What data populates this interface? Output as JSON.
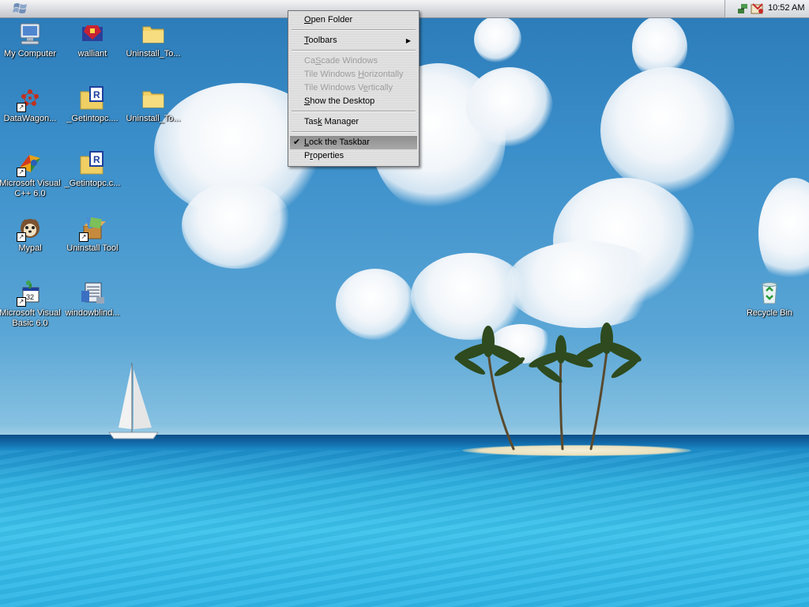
{
  "taskbar": {
    "start_icon": "windows-flag-icon",
    "tray_icons": [
      "network-icon",
      "system-tray-app-icon"
    ],
    "clock": "10:52 AM"
  },
  "desktop_icons": [
    {
      "id": "my-computer",
      "label": "My Computer",
      "icon": "computer-icon",
      "shortcut": false
    },
    {
      "id": "walliant",
      "label": "walliant",
      "icon": "walliant-icon",
      "shortcut": false
    },
    {
      "id": "uninstall-to-1",
      "label": "Uninstall_To...",
      "icon": "folder-icon",
      "shortcut": false
    },
    {
      "id": "datawagon",
      "label": "DataWagon...",
      "icon": "datawagon-icon",
      "shortcut": true
    },
    {
      "id": "getintopc-1",
      "label": "_Getintopc....",
      "icon": "winrar-archive-icon",
      "shortcut": false
    },
    {
      "id": "uninstall-to-2",
      "label": "Uninstall_To...",
      "icon": "folder-icon",
      "shortcut": false
    },
    {
      "id": "ms-visual-cpp",
      "label": "Microsoft Visual C++ 6.0",
      "label_line1": "Microsoft Visual",
      "label_line2": "C++ 6.0",
      "icon": "visual-cpp-icon",
      "shortcut": true
    },
    {
      "id": "getintopc-2",
      "label": "_Getintopc.c...",
      "icon": "winrar-archive-icon",
      "shortcut": false
    },
    {
      "id": "mypal",
      "label": "Mypal",
      "icon": "mypal-browser-icon",
      "shortcut": true
    },
    {
      "id": "uninstall-tool",
      "label": "Uninstall Tool",
      "icon": "uninstall-tool-icon",
      "shortcut": true
    },
    {
      "id": "ms-visual-basic",
      "label": "Microsoft Visual Basic 6.0",
      "label_line1": "Microsoft Visual",
      "label_line2": "Basic 6.0",
      "icon": "visual-basic-icon",
      "shortcut": true
    },
    {
      "id": "windowblinds",
      "label": "windowblind...",
      "icon": "windowblinds-icon",
      "shortcut": false
    },
    {
      "id": "recycle-bin",
      "label": "Recycle Bin",
      "icon": "recycle-bin-icon",
      "shortcut": false
    }
  ],
  "context_menu": {
    "items": [
      {
        "label": "Open Folder",
        "accel": "O",
        "rest": "pen Folder",
        "enabled": true
      },
      {
        "label": "Toolbars",
        "accel": "T",
        "rest": "oolbars",
        "enabled": true,
        "submenu": true
      },
      {
        "label": "Cascade Windows",
        "accel": "S",
        "pre": "Ca",
        "rest": "cade Windows",
        "enabled": false
      },
      {
        "label": "Tile Windows Horizontally",
        "pre": "Tile Windows ",
        "accel": "H",
        "rest": "orizontally",
        "enabled": false
      },
      {
        "label": "Tile Windows Vertically",
        "pre": "Tile Windows V",
        "accel": "e",
        "rest": "rtically",
        "enabled": false
      },
      {
        "label": "Show the Desktop",
        "accel": "S",
        "rest": "how the Desktop",
        "enabled": true
      },
      {
        "label": "Task Manager",
        "pre": "Tas",
        "accel": "k",
        "rest": " Manager",
        "enabled": true
      },
      {
        "label": "Lock the Taskbar",
        "accel": "L",
        "rest": "ock the Taskbar",
        "enabled": true,
        "checked": true,
        "highlighted": true
      },
      {
        "label": "Properties",
        "pre": "P",
        "accel": "r",
        "rest": "operties",
        "enabled": true
      }
    ]
  },
  "colors": {
    "menu_background": "#e2e2e2",
    "menu_highlight": "#9a9a9a",
    "menu_disabled_text": "#9d9d9d",
    "icon_label_text": "#ffffff"
  }
}
